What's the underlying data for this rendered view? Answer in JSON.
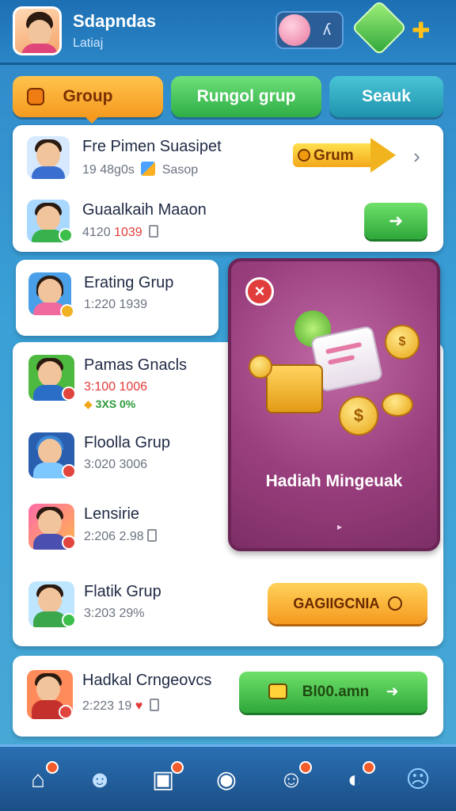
{
  "header": {
    "title": "Sdapndas",
    "subtitle": "Latiaj",
    "badge_symbol": "ʎ",
    "key_symbol": "✚"
  },
  "tabs": [
    {
      "label": "Group"
    },
    {
      "label": "Rungol grup"
    },
    {
      "label": "Seauk"
    }
  ],
  "top_card": {
    "item1": {
      "name": "Fre Pimen Suasipet",
      "meta_prefix": "19 48g0s",
      "meta_suffix": "Sasop",
      "action_label": "Grum"
    },
    "item2": {
      "name": "Guaalkaih Maaon",
      "meta_prefix": "4120",
      "meta_red": "1039",
      "action_label": "➜"
    }
  },
  "left_list": [
    {
      "name": "Erating Grup",
      "meta": "1:220 1939"
    },
    {
      "name": "Pamas Gnacls",
      "meta": "3:100 1006",
      "extra": "3XS 0%"
    },
    {
      "name": "Floolla Grup",
      "meta": "3:020 3006"
    },
    {
      "name": "Lensirie",
      "meta": "2:206 2.98"
    },
    {
      "name": "Flatik Grup",
      "meta": "3:203 29%",
      "action_label": "GAGIIGCNIA"
    }
  ],
  "promo": {
    "close_label": "×",
    "title": "Hadiah Mingeuak",
    "more": "▸"
  },
  "bottom_card": {
    "name": "Hadkal Crngeovcs",
    "meta": "2:223 19",
    "action_label": "Bl00.amn"
  },
  "nav": [
    {
      "icon": "home-icon",
      "glyph": "⌂"
    },
    {
      "icon": "users-icon",
      "glyph": "☻"
    },
    {
      "icon": "chat-box-icon",
      "glyph": "▣"
    },
    {
      "icon": "location-icon",
      "glyph": "◉"
    },
    {
      "icon": "friends-icon",
      "glyph": "☺"
    },
    {
      "icon": "clock-icon",
      "glyph": "◐"
    },
    {
      "icon": "profile-icon",
      "glyph": "☹"
    }
  ],
  "colors": {
    "accent_orange": "#f59a1f",
    "accent_green": "#2ea83a",
    "promo_purple": "#9a3f7e",
    "header_blue": "#1d6fb3"
  }
}
